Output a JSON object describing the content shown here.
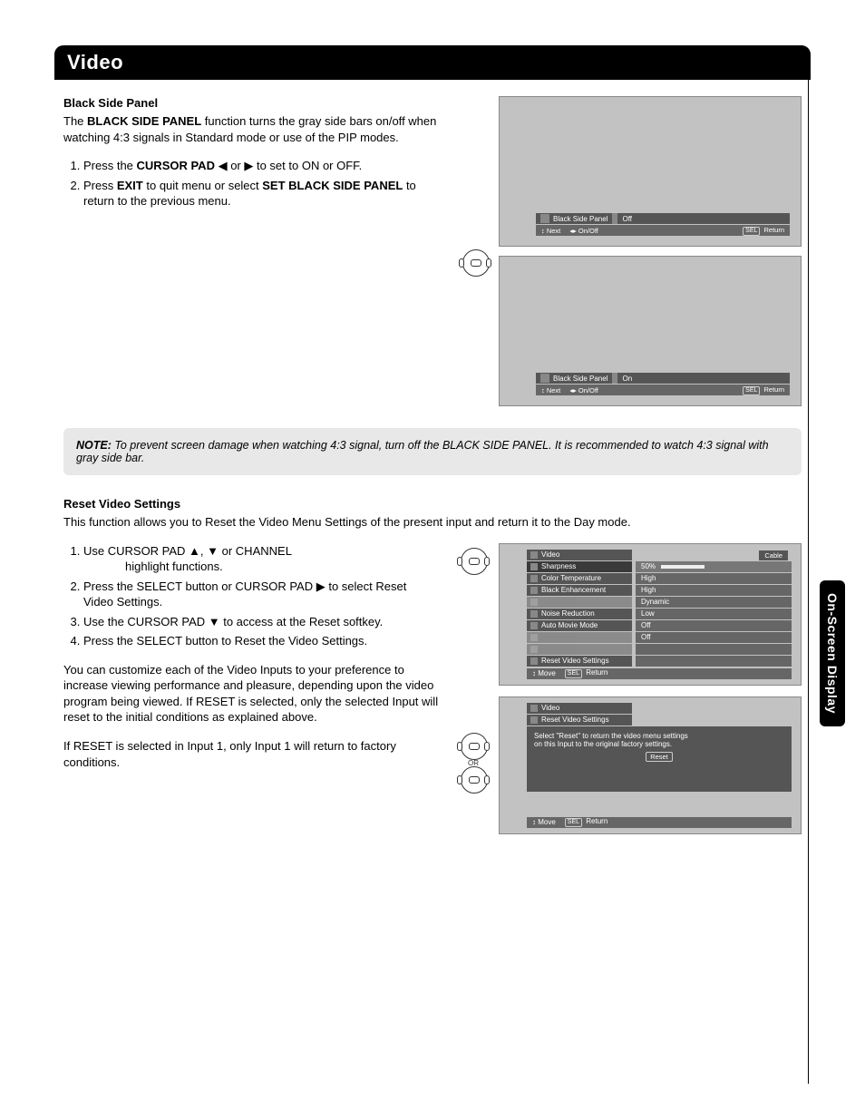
{
  "title": "Video",
  "side_tab": "On-Screen Display",
  "section1": {
    "heading": "Black Side Panel",
    "intro_pre": "The ",
    "intro_bold": "BLACK SIDE PANEL",
    "intro_post": " function turns the gray side bars on/off when watching 4:3 signals in Standard mode or use of the PIP modes.",
    "steps": {
      "s1_pre": "Press the ",
      "s1_bold": "CURSOR PAD",
      "s1_post": " ◀ or ▶ to set to ON or OFF.",
      "s2_pre": "Press ",
      "s2_b1": "EXIT",
      "s2_mid": " to quit menu or select ",
      "s2_b2": "SET BLACK SIDE PANEL",
      "s2_post": " to return to the previous menu."
    },
    "osd": {
      "item": "Black Side Panel",
      "off": "Off",
      "on": "On",
      "hint_next": "Next",
      "hint_onoff": "On/Off",
      "hint_sel": "SEL",
      "hint_return": "Return"
    }
  },
  "note": {
    "label": "NOTE:",
    "text": "To prevent screen damage when watching 4:3 signal, turn off the BLACK SIDE PANEL.  It is recommended to watch 4:3 signal with gray side bar."
  },
  "section2": {
    "heading": "Reset Video Settings",
    "intro": "This function allows you to Reset the Video Menu Settings of the present input and return it to the Day mode.",
    "steps": {
      "s1": "Use CURSOR PAD ▲, ▼ or CHANNEL",
      "s1b": "highlight functions.",
      "s2": "Press the SELECT button or CURSOR PAD ▶ to select Reset Video Settings.",
      "s3": "Use the CURSOR PAD ▼ to access at the Reset softkey.",
      "s4": "Press the SELECT button to Reset the Video Settings."
    },
    "para2": "You can customize each of the Video Inputs to your preference to increase viewing performance and pleasure, depending upon the video program being viewed. If RESET is selected, only the selected Input will reset to the initial conditions as explained above.",
    "para3": "If RESET is selected in Input 1, only Input 1 will return to factory conditions.",
    "or": "OR"
  },
  "menu": {
    "title": "Video",
    "cable": "Cable",
    "rows": [
      {
        "label": "Sharpness",
        "value": "50%",
        "bar": true,
        "hl": true
      },
      {
        "label": "Color Temperature",
        "value": "High"
      },
      {
        "label": "Black Enhancement",
        "value": "High"
      },
      {
        "label": "",
        "value": "Dynamic"
      },
      {
        "label": "Noise Reduction",
        "value": "Low"
      },
      {
        "label": "Auto Movie Mode",
        "value": "Off"
      },
      {
        "label": "",
        "value": "Off"
      },
      {
        "label": "",
        "value": ""
      },
      {
        "label": "Reset Video Settings",
        "value": ""
      }
    ],
    "foot_move": "Move",
    "foot_sel": "SEL",
    "foot_return": "Return"
  },
  "reset_panel": {
    "title": "Video",
    "row": "Reset Video Settings",
    "msg1": "Select \"Reset\" to return the video menu settings",
    "msg2": "on this Input to the original factory settings.",
    "btn": "Reset",
    "foot_move": "Move",
    "foot_sel": "SEL",
    "foot_return": "Return"
  }
}
